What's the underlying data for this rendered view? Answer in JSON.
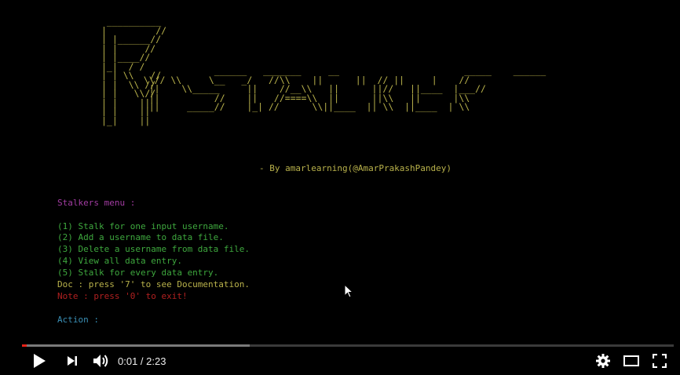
{
  "terminal": {
    "ascii_art_p": " __________\n|         //\n| |______//\n| |     //\n| |____//\n|_|  / /\n| | \\\\   //\n| |  \\\\ //\n| |   \\\\//\n| |    ||\n| |    ||\n|_|    ||",
    "ascii_art_stalker": "                ______   _______     __                       _____    ______\n   \\\\// \\\\     \\__   _/   //\\\\    ||      ||  // ||     |    //\n    ||    \\\\_____     ||    //__\\\\   ||      ||//   ||____  |___//\n    ||          //    ||   //====\\\\  ||      ||\\\\   ||      |\\\\\n    ||     _____//    |_| //      \\\\||____  || \\\\  ||____  | \\\\",
    "byline": "- By amarlearning(@AmarPrakashPandey)",
    "menu_title": "Stalkers menu :",
    "menu_items": [
      "(1) Stalk for one input username.",
      "(2) Add a username to data file.",
      "(3) Delete a username from data file.",
      "(4) View all data entry.",
      "(5) Stalk for every data entry."
    ],
    "doc_line": "Doc : press '7' to see Documentation.",
    "note_line": "Note : press '0' to exit!",
    "action_prompt": "Action :"
  },
  "player": {
    "current_time": "0:01",
    "separator": " / ",
    "duration": "2:23",
    "played_fraction": 0.007,
    "buffered_fraction": 0.349
  },
  "colors": {
    "ascii": "#b9b24b",
    "menu_title": "#a23ca2",
    "menu_item": "#3ea83e",
    "doc": "#b9b24b",
    "note": "#b02020",
    "action": "#3a8fb5",
    "progress_played": "#e62117"
  },
  "icons": [
    "play-icon",
    "next-icon",
    "volume-icon",
    "settings-icon",
    "theater-icon",
    "fullscreen-icon",
    "mouse-cursor-icon"
  ]
}
